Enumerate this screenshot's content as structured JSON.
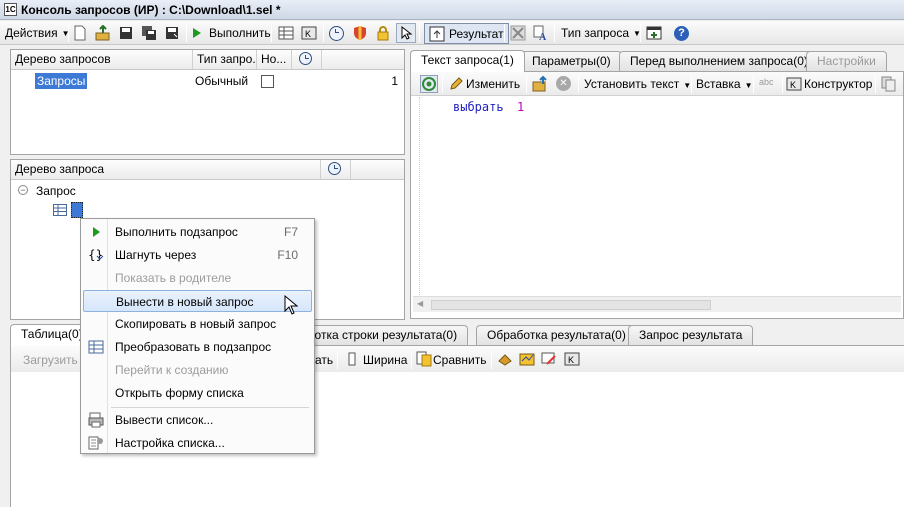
{
  "window": {
    "title": "Консоль запросов (ИР) : C:\\Download\\1.sel *",
    "app_icon": "1C"
  },
  "toolbar": {
    "actions_label": "Действия",
    "execute_label": "Выполнить",
    "result_label": "Результат",
    "query_type_label": "Тип запроса"
  },
  "queries_tree": {
    "columns": [
      "Дерево запросов",
      "Тип запро...",
      "Но..."
    ],
    "rows": [
      {
        "name": "Запросы",
        "type": "Обычный",
        "count": "1"
      }
    ]
  },
  "query_tree": {
    "header": "Дерево запроса",
    "root": "Запрос"
  },
  "query_tabs": [
    "Текст запроса(1)",
    "Параметры(0)",
    "Перед выполнением запроса(0)",
    "Настройки"
  ],
  "editor_toolbar": {
    "change_label": "Изменить",
    "set_text_label": "Установить текст",
    "insert_label": "Вставка",
    "constructor_label": "Конструктор"
  },
  "editor": {
    "keyword": "выбрать",
    "value": "1"
  },
  "bottom_tabs": [
    "Таблица(0)",
    "аботка строки результата(0)",
    "Обработка результата(0)",
    "Запрос результата"
  ],
  "bottom_toolbar": {
    "load_label": "Загрузить",
    "partial_label": "ать",
    "width_label": "Ширина",
    "compare_label": "Сравнить"
  },
  "context_menu": {
    "items": [
      {
        "label": "Выполнить подзапрос",
        "shortcut": "F7"
      },
      {
        "label": "Шагнуть через",
        "shortcut": "F10"
      },
      {
        "label": "Показать в родителе"
      },
      {
        "label": "Вынести в новый запрос"
      },
      {
        "label": "Скопировать в новый запрос"
      },
      {
        "label": "Преобразовать в подзапрос"
      },
      {
        "label": "Перейти к созданию"
      },
      {
        "label": "Открыть форму списка"
      },
      {
        "label": "Вывести список..."
      },
      {
        "label": "Настройка списка..."
      }
    ]
  },
  "colors": {
    "keyword": "#1f1fbf",
    "number": "#c000c0",
    "selection": "#3d7ad6",
    "help": "#2d5fb8"
  }
}
